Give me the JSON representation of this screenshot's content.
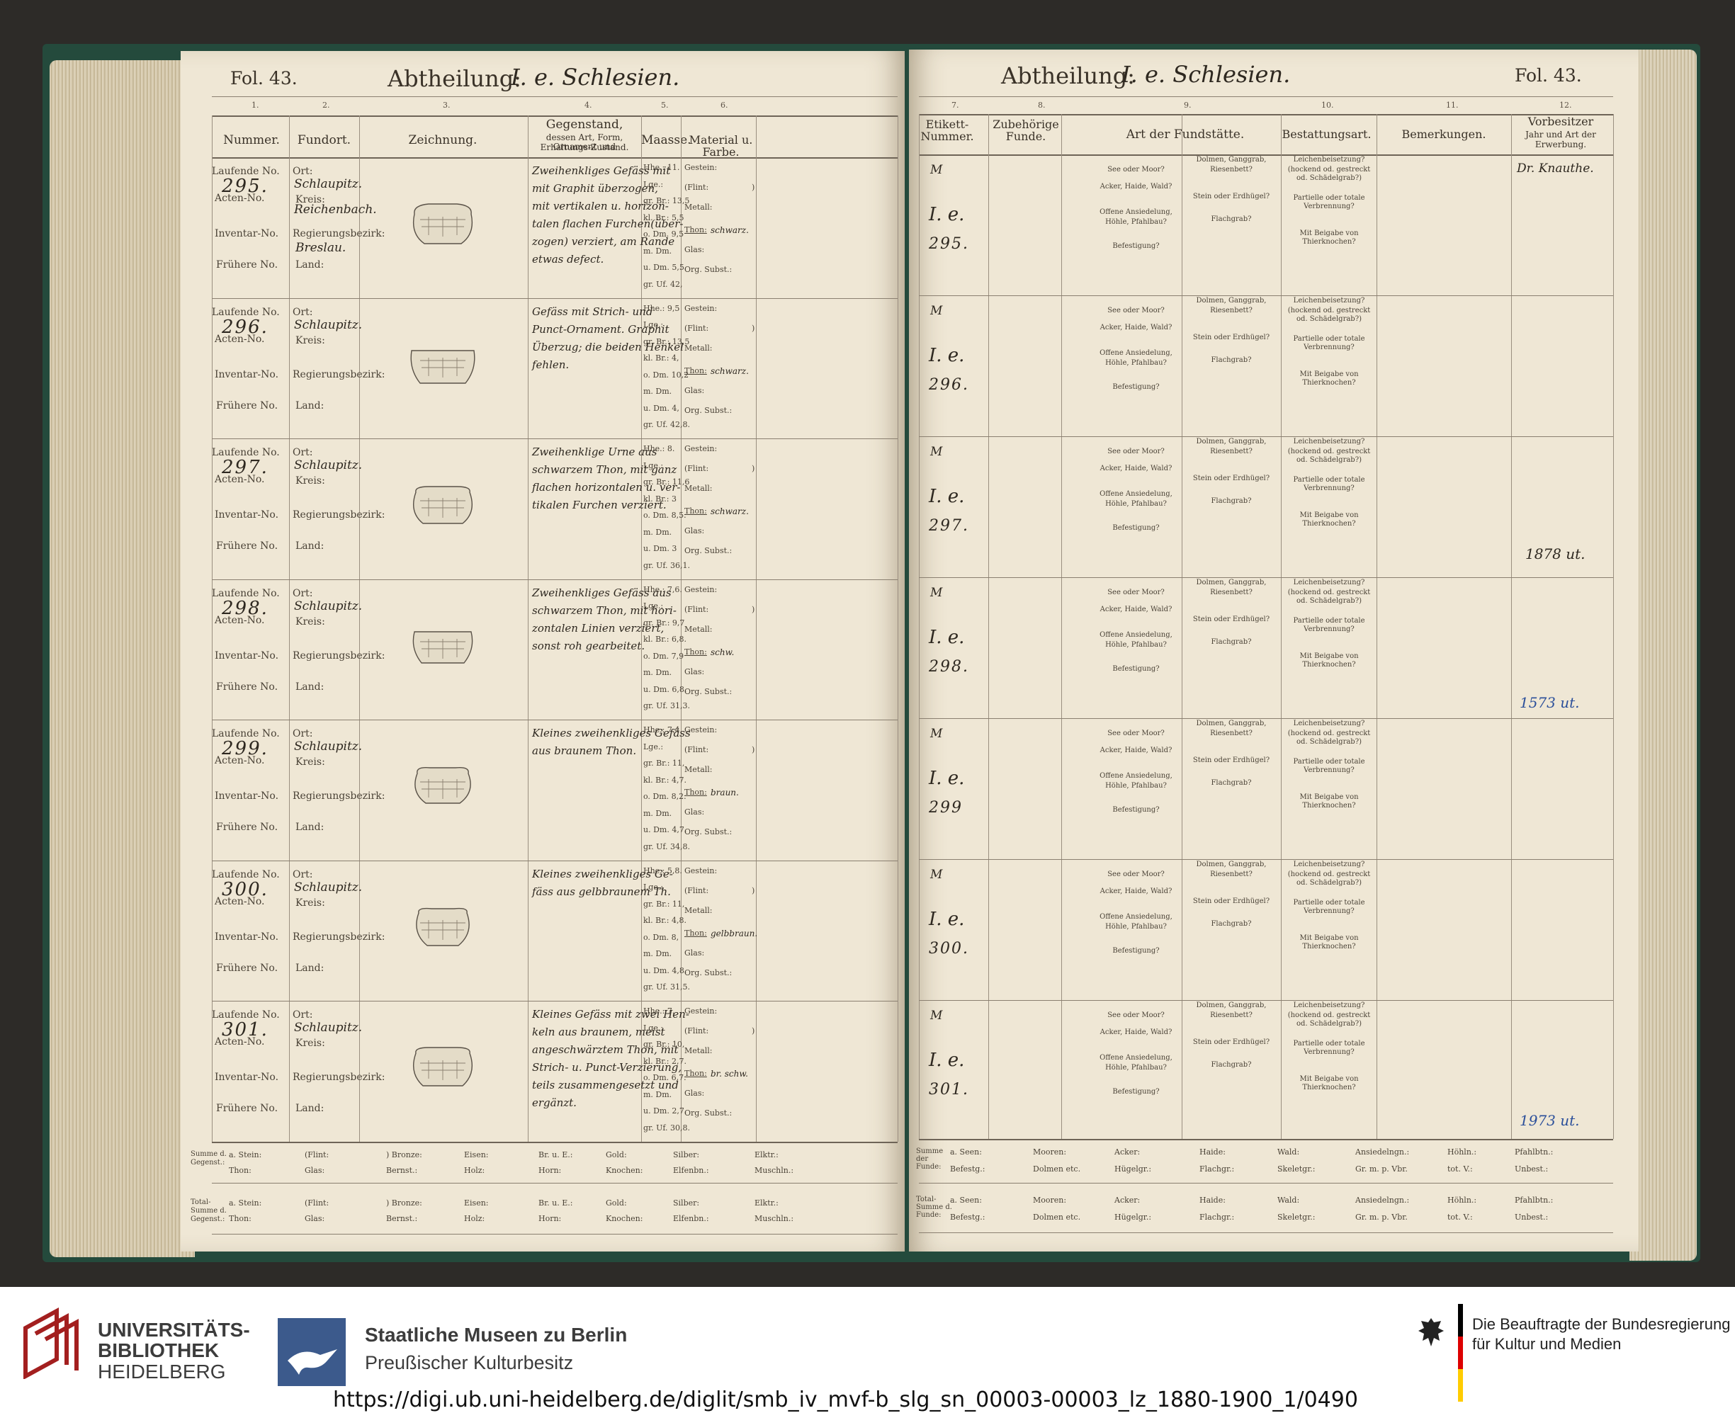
{
  "left_page": {
    "fol": "Fol. 43.",
    "abtheilung_label": "Abtheilung:",
    "abtheilung_value": "I. e. Schlesien.",
    "col_numbers": [
      "1.",
      "2.",
      "3.",
      "4.",
      "5.",
      "6."
    ],
    "col_headers": {
      "nummer": "Nummer.",
      "fundort": "Fundort.",
      "zeichnung": "Zeichnung.",
      "gegenstand": "Gegenstand,",
      "gegenstand_sub1": "dessen Art, Form, Ornament und",
      "gegenstand_sub2": "Erhaltungs-Zustand.",
      "maasse": "Maasse.",
      "material": "Material u. Farbe."
    },
    "row_labels": {
      "laufende": "Laufende No.",
      "acten": "Acten-No.",
      "inventar": "Inventar-No.",
      "fruehere": "Frühere No.",
      "ort": "Ort:",
      "kreis": "Kreis:",
      "regbez": "Regierungsbezirk:",
      "land": "Land:",
      "gestein": "Gestein:",
      "flint": "(Flint:",
      "metall": "Metall:",
      "thon": "Thon:",
      "glas": "Glas:",
      "orgsubst": "Org. Subst.:"
    },
    "entries": [
      {
        "nummer": "295.",
        "ort": "Schlaupitz.",
        "kreis": "Reichenbach.",
        "regbez": "Breslau.",
        "gegenstand": [
          "Zweihenkliges Gefäss mit",
          "mit Graphit überzogen,",
          "mit vertikalen u. horizon-",
          "talen flachen Furchen(über-",
          "zogen) verziert, am Rande",
          "etwas defect."
        ],
        "maasse": [
          "Hhe.: 11.",
          "Lge.:",
          "gr. Br.: 13,5",
          "kl. Br.: 5,5",
          "o. Dm. 9,5",
          "m. Dm.",
          "u. Dm. 5,5",
          "gr. Uf. 42,"
        ],
        "thon": "schwarz."
      },
      {
        "nummer": "296.",
        "ort": "Schlaupitz.",
        "kreis": "",
        "regbez": "",
        "gegenstand": [
          "Gefäss mit Strich- und",
          "Punct-Ornament. Graphit",
          "Überzug; die beiden Henkel",
          "fehlen."
        ],
        "maasse": [
          "Hhe.: 9,5",
          "Lge.:",
          "gr. Br.: 13,5",
          "kl. Br.: 4,",
          "o. Dm. 10,2",
          "m. Dm.",
          "u. Dm. 4,",
          "gr. Uf. 42,8."
        ],
        "thon": "schwarz."
      },
      {
        "nummer": "297.",
        "ort": "Schlaupitz.",
        "kreis": "",
        "regbez": "",
        "gegenstand": [
          "Zweihenklige Urne aus",
          "schwarzem Thon, mit ganz",
          "flachen horizontalen u. ver-",
          "tikalen Furchen verziert."
        ],
        "maasse": [
          "Hhe.: 8.",
          "Lge.:",
          "gr. Br.: 11,6",
          "kl. Br.: 3",
          "o. Dm. 8,5.",
          "m. Dm.",
          "u. Dm. 3",
          "gr. Uf. 36,1."
        ],
        "thon": "schwarz."
      },
      {
        "nummer": "298.",
        "ort": "Schlaupitz.",
        "kreis": "",
        "regbez": "",
        "gegenstand": [
          "Zweihenkliges Gefäss aus",
          "schwarzem Thon, mit hori-",
          "zontalen Linien verziert,",
          "sonst roh gearbeitet."
        ],
        "maasse": [
          "Hhe.: 7,6.",
          "Lge.:",
          "gr. Br.: 9,7",
          "kl. Br.: 6,8.",
          "o. Dm. 7,9",
          "m. Dm.",
          "u. Dm. 6,8.",
          "gr. Uf. 31,3."
        ],
        "thon": "schw."
      },
      {
        "nummer": "299.",
        "ort": "Schlaupitz.",
        "kreis": "",
        "regbez": "",
        "gegenstand": [
          "Kleines zweihenkliges Gefäss",
          "aus braunem Thon."
        ],
        "maasse": [
          "Hhe.: 7,4.",
          "Lge.:",
          "gr. Br.: 11,",
          "kl. Br.: 4,7.",
          "o. Dm. 8,2.",
          "m. Dm.",
          "u. Dm. 4,7.",
          "gr. Uf. 34,8."
        ],
        "thon": "braun."
      },
      {
        "nummer": "300.",
        "ort": "Schlaupitz.",
        "kreis": "",
        "regbez": "",
        "gegenstand": [
          "Kleines zweihenkliges Ge-",
          "fäss aus gelbbraunem Th."
        ],
        "maasse": [
          "Hhe.: 5,8.",
          "Lge.:",
          "gr. Br.: 11,",
          "kl. Br.: 4,8.",
          "o. Dm. 8,",
          "m. Dm.",
          "u. Dm. 4,8.",
          "gr. Uf. 31,5."
        ],
        "thon": "gelbbraun."
      },
      {
        "nummer": "301.",
        "ort": "Schlaupitz.",
        "kreis": "",
        "regbez": "",
        "gegenstand": [
          "Kleines Gefäss mit zwei Hen-",
          "keln aus braunem, meist",
          "angeschwärztem Thon, mit",
          "Strich- u. Punct-Verzierung,",
          "teils zusammengesetzt und",
          "ergänzt."
        ],
        "maasse": [
          "Hhe.: 7.",
          "Lge.:",
          "gr. Br.: 10,",
          "kl. Br.: 2,7.",
          "o. Dm. 6,7.",
          "m. Dm.",
          "u. Dm. 2,7.",
          "gr. Uf. 30,8."
        ],
        "thon": "br. schw."
      }
    ],
    "summe_label": [
      "Summe d.",
      "Gegenst.:"
    ],
    "total_label": [
      "Total-",
      "Summe d.",
      "Gegenst.:"
    ],
    "summe_row1": [
      "a. Stein:",
      "(Flint:",
      ") Bronze:",
      "Eisen:",
      "Br. u. E.:",
      "Gold:",
      "Silber:",
      "Elktr.:"
    ],
    "summe_row2": [
      "Thon:",
      "Glas:",
      "Bernst.:",
      "Holz:",
      "Horn:",
      "Knochen:",
      "Elfenbn.:",
      "Muschln.:"
    ]
  },
  "right_page": {
    "fol": "Fol. 43.",
    "abtheilung_label": "Abtheilung:",
    "abtheilung_value": "I. e. Schlesien.",
    "col_numbers": [
      "7.",
      "8.",
      "9.",
      "10.",
      "11.",
      "12."
    ],
    "col_headers": {
      "etikett": [
        "Etikett-",
        "Nummer."
      ],
      "zubehoerige": [
        "Zubehörige",
        "Funde."
      ],
      "fundstaette": "Art der Fundstätte.",
      "bestattung": "Bestattungsart.",
      "bemerkungen": "Bemerkungen.",
      "vorbesitzer": "Vorbesitzer",
      "vorbesitzer_sub": [
        "Jahr und Art der",
        "Erwerbung."
      ]
    },
    "fund_labels": [
      "See oder Moor?",
      "Acker, Haide, Wald?",
      "Offene Ansiedelung,",
      "Höhle, Pfahlbau?",
      "Befestigung?"
    ],
    "grab_labels": [
      "Dolmen, Ganggrab,",
      "Riesenbett?",
      "Stein oder Erdhügel?",
      "Flachgrab?"
    ],
    "bestattung_labels": [
      "Leichenbeisetzung?",
      "(hockend od. gestreckt",
      "od. Schädelgrab?)",
      "Partielle oder totale",
      "Verbrennung?",
      "Mit Beigabe von",
      "Thierknochen?"
    ],
    "etikett_prefix": "M",
    "etikett_group": "I. e.",
    "etiketten": [
      "295.",
      "296.",
      "297.",
      "298.",
      "299",
      "300.",
      "301."
    ],
    "vorbesitzer_295": "Dr. Knauthe.",
    "annotations": [
      "1878 ut.",
      "1573 ut.",
      "1973 ut."
    ],
    "summe_label": [
      "Summe",
      "der",
      "Funde:"
    ],
    "total_label": [
      "Total-",
      "Summe d.",
      "Funde:"
    ],
    "summe_row1": [
      "a. Seen:",
      "Mooren:",
      "Acker:",
      "Haide:",
      "Wald:",
      "Ansiedelngn.:",
      "Höhln.:",
      "Pfahlbtn.:"
    ],
    "summe_row2": [
      "Befestg.:",
      "Dolmen etc.",
      "Hügelgr.:",
      "Flachgr.:",
      "Skeletgr.:",
      "Gr. m. p. Vbr.",
      "tot. V.:",
      "Unbest.:"
    ]
  },
  "footer": {
    "ub_logo_line1": "UNIVERSITÄTS-",
    "ub_logo_line2": "BIBLIOTHEK",
    "ub_logo_line3": "HEIDELBERG",
    "smb_line1": "Staatliche Museen zu Berlin",
    "smb_line2": "Preußischer Kulturbesitz",
    "bkm_line1": "Die Beauftragte der Bundesregierung",
    "bkm_line2": "für Kultur und Medien",
    "url": "https://digi.ub.uni-heidelberg.de/diglit/smb_iv_mvf-b_slg_sn_00003-00003_lz_1880-1900_1/0490",
    "colors": {
      "ub_red": "#a31f1f",
      "smb_blue": "#3c5a8c",
      "flag_black": "#000000",
      "flag_red": "#dd0000",
      "flag_gold": "#ffcc00"
    }
  }
}
